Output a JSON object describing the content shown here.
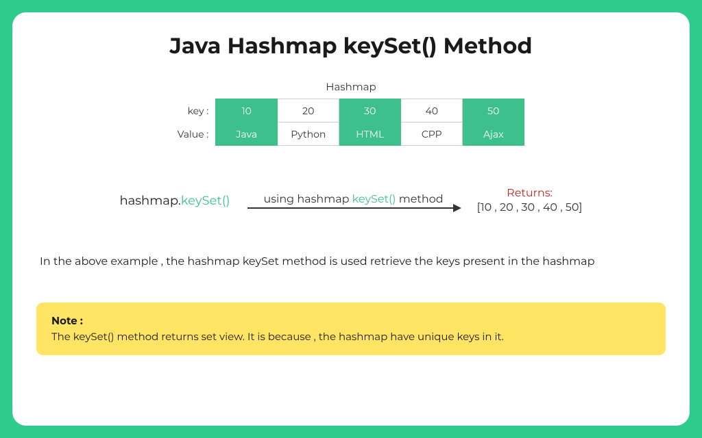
{
  "title": "Java Hashmap keySet() Method",
  "hashmap": {
    "heading": "Hashmap",
    "keyLabel": "key :",
    "valueLabel": "Value :",
    "cells": [
      {
        "key": "10",
        "value": "Java",
        "shade": "green"
      },
      {
        "key": "20",
        "value": "Python",
        "shade": "white"
      },
      {
        "key": "30",
        "value": "HTML",
        "shade": "green"
      },
      {
        "key": "40",
        "value": "CPP",
        "shade": "white"
      },
      {
        "key": "50",
        "value": "Ajax",
        "shade": "green"
      }
    ]
  },
  "method": {
    "objPart": "hashmap.",
    "callPart": "keySet()",
    "arrowPrefix": "using hashmap ",
    "arrowHighlight": "keySet()",
    "arrowSuffix": " method",
    "returnsLabel": "Returns:",
    "returnsValue": "[10 , 20 , 30 , 40 , 50]"
  },
  "description": "In the above example , the hashmap keySet method is used retrieve the keys present in the hashmap",
  "note": {
    "title": "Note :",
    "body": "The keySet() method returns set view. It is because , the hashmap  have unique keys in it."
  },
  "colors": {
    "accent": "#3dc08c",
    "background": "#2dcb8c",
    "noteBg": "#ffe563",
    "returns": "#b82828"
  }
}
